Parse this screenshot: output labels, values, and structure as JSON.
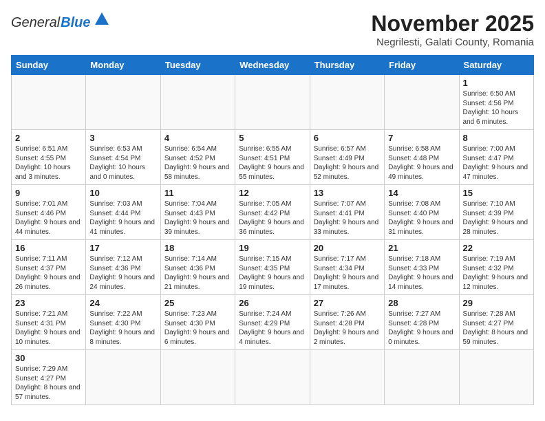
{
  "logo": {
    "general": "General",
    "blue": "Blue"
  },
  "title": "November 2025",
  "subtitle": "Negrilesti, Galati County, Romania",
  "weekdays": [
    "Sunday",
    "Monday",
    "Tuesday",
    "Wednesday",
    "Thursday",
    "Friday",
    "Saturday"
  ],
  "weeks": [
    [
      {
        "day": "",
        "info": ""
      },
      {
        "day": "",
        "info": ""
      },
      {
        "day": "",
        "info": ""
      },
      {
        "day": "",
        "info": ""
      },
      {
        "day": "",
        "info": ""
      },
      {
        "day": "",
        "info": ""
      },
      {
        "day": "1",
        "info": "Sunrise: 6:50 AM\nSunset: 4:56 PM\nDaylight: 10 hours and 6 minutes."
      }
    ],
    [
      {
        "day": "2",
        "info": "Sunrise: 6:51 AM\nSunset: 4:55 PM\nDaylight: 10 hours and 3 minutes."
      },
      {
        "day": "3",
        "info": "Sunrise: 6:53 AM\nSunset: 4:54 PM\nDaylight: 10 hours and 0 minutes."
      },
      {
        "day": "4",
        "info": "Sunrise: 6:54 AM\nSunset: 4:52 PM\nDaylight: 9 hours and 58 minutes."
      },
      {
        "day": "5",
        "info": "Sunrise: 6:55 AM\nSunset: 4:51 PM\nDaylight: 9 hours and 55 minutes."
      },
      {
        "day": "6",
        "info": "Sunrise: 6:57 AM\nSunset: 4:49 PM\nDaylight: 9 hours and 52 minutes."
      },
      {
        "day": "7",
        "info": "Sunrise: 6:58 AM\nSunset: 4:48 PM\nDaylight: 9 hours and 49 minutes."
      },
      {
        "day": "8",
        "info": "Sunrise: 7:00 AM\nSunset: 4:47 PM\nDaylight: 9 hours and 47 minutes."
      }
    ],
    [
      {
        "day": "9",
        "info": "Sunrise: 7:01 AM\nSunset: 4:46 PM\nDaylight: 9 hours and 44 minutes."
      },
      {
        "day": "10",
        "info": "Sunrise: 7:03 AM\nSunset: 4:44 PM\nDaylight: 9 hours and 41 minutes."
      },
      {
        "day": "11",
        "info": "Sunrise: 7:04 AM\nSunset: 4:43 PM\nDaylight: 9 hours and 39 minutes."
      },
      {
        "day": "12",
        "info": "Sunrise: 7:05 AM\nSunset: 4:42 PM\nDaylight: 9 hours and 36 minutes."
      },
      {
        "day": "13",
        "info": "Sunrise: 7:07 AM\nSunset: 4:41 PM\nDaylight: 9 hours and 33 minutes."
      },
      {
        "day": "14",
        "info": "Sunrise: 7:08 AM\nSunset: 4:40 PM\nDaylight: 9 hours and 31 minutes."
      },
      {
        "day": "15",
        "info": "Sunrise: 7:10 AM\nSunset: 4:39 PM\nDaylight: 9 hours and 28 minutes."
      }
    ],
    [
      {
        "day": "16",
        "info": "Sunrise: 7:11 AM\nSunset: 4:37 PM\nDaylight: 9 hours and 26 minutes."
      },
      {
        "day": "17",
        "info": "Sunrise: 7:12 AM\nSunset: 4:36 PM\nDaylight: 9 hours and 24 minutes."
      },
      {
        "day": "18",
        "info": "Sunrise: 7:14 AM\nSunset: 4:36 PM\nDaylight: 9 hours and 21 minutes."
      },
      {
        "day": "19",
        "info": "Sunrise: 7:15 AM\nSunset: 4:35 PM\nDaylight: 9 hours and 19 minutes."
      },
      {
        "day": "20",
        "info": "Sunrise: 7:17 AM\nSunset: 4:34 PM\nDaylight: 9 hours and 17 minutes."
      },
      {
        "day": "21",
        "info": "Sunrise: 7:18 AM\nSunset: 4:33 PM\nDaylight: 9 hours and 14 minutes."
      },
      {
        "day": "22",
        "info": "Sunrise: 7:19 AM\nSunset: 4:32 PM\nDaylight: 9 hours and 12 minutes."
      }
    ],
    [
      {
        "day": "23",
        "info": "Sunrise: 7:21 AM\nSunset: 4:31 PM\nDaylight: 9 hours and 10 minutes."
      },
      {
        "day": "24",
        "info": "Sunrise: 7:22 AM\nSunset: 4:30 PM\nDaylight: 9 hours and 8 minutes."
      },
      {
        "day": "25",
        "info": "Sunrise: 7:23 AM\nSunset: 4:30 PM\nDaylight: 9 hours and 6 minutes."
      },
      {
        "day": "26",
        "info": "Sunrise: 7:24 AM\nSunset: 4:29 PM\nDaylight: 9 hours and 4 minutes."
      },
      {
        "day": "27",
        "info": "Sunrise: 7:26 AM\nSunset: 4:28 PM\nDaylight: 9 hours and 2 minutes."
      },
      {
        "day": "28",
        "info": "Sunrise: 7:27 AM\nSunset: 4:28 PM\nDaylight: 9 hours and 0 minutes."
      },
      {
        "day": "29",
        "info": "Sunrise: 7:28 AM\nSunset: 4:27 PM\nDaylight: 8 hours and 59 minutes."
      }
    ],
    [
      {
        "day": "30",
        "info": "Sunrise: 7:29 AM\nSunset: 4:27 PM\nDaylight: 8 hours and 57 minutes."
      },
      {
        "day": "",
        "info": ""
      },
      {
        "day": "",
        "info": ""
      },
      {
        "day": "",
        "info": ""
      },
      {
        "day": "",
        "info": ""
      },
      {
        "day": "",
        "info": ""
      },
      {
        "day": "",
        "info": ""
      }
    ]
  ],
  "colors": {
    "header_bg": "#1a73c8",
    "border": "#cccccc"
  }
}
